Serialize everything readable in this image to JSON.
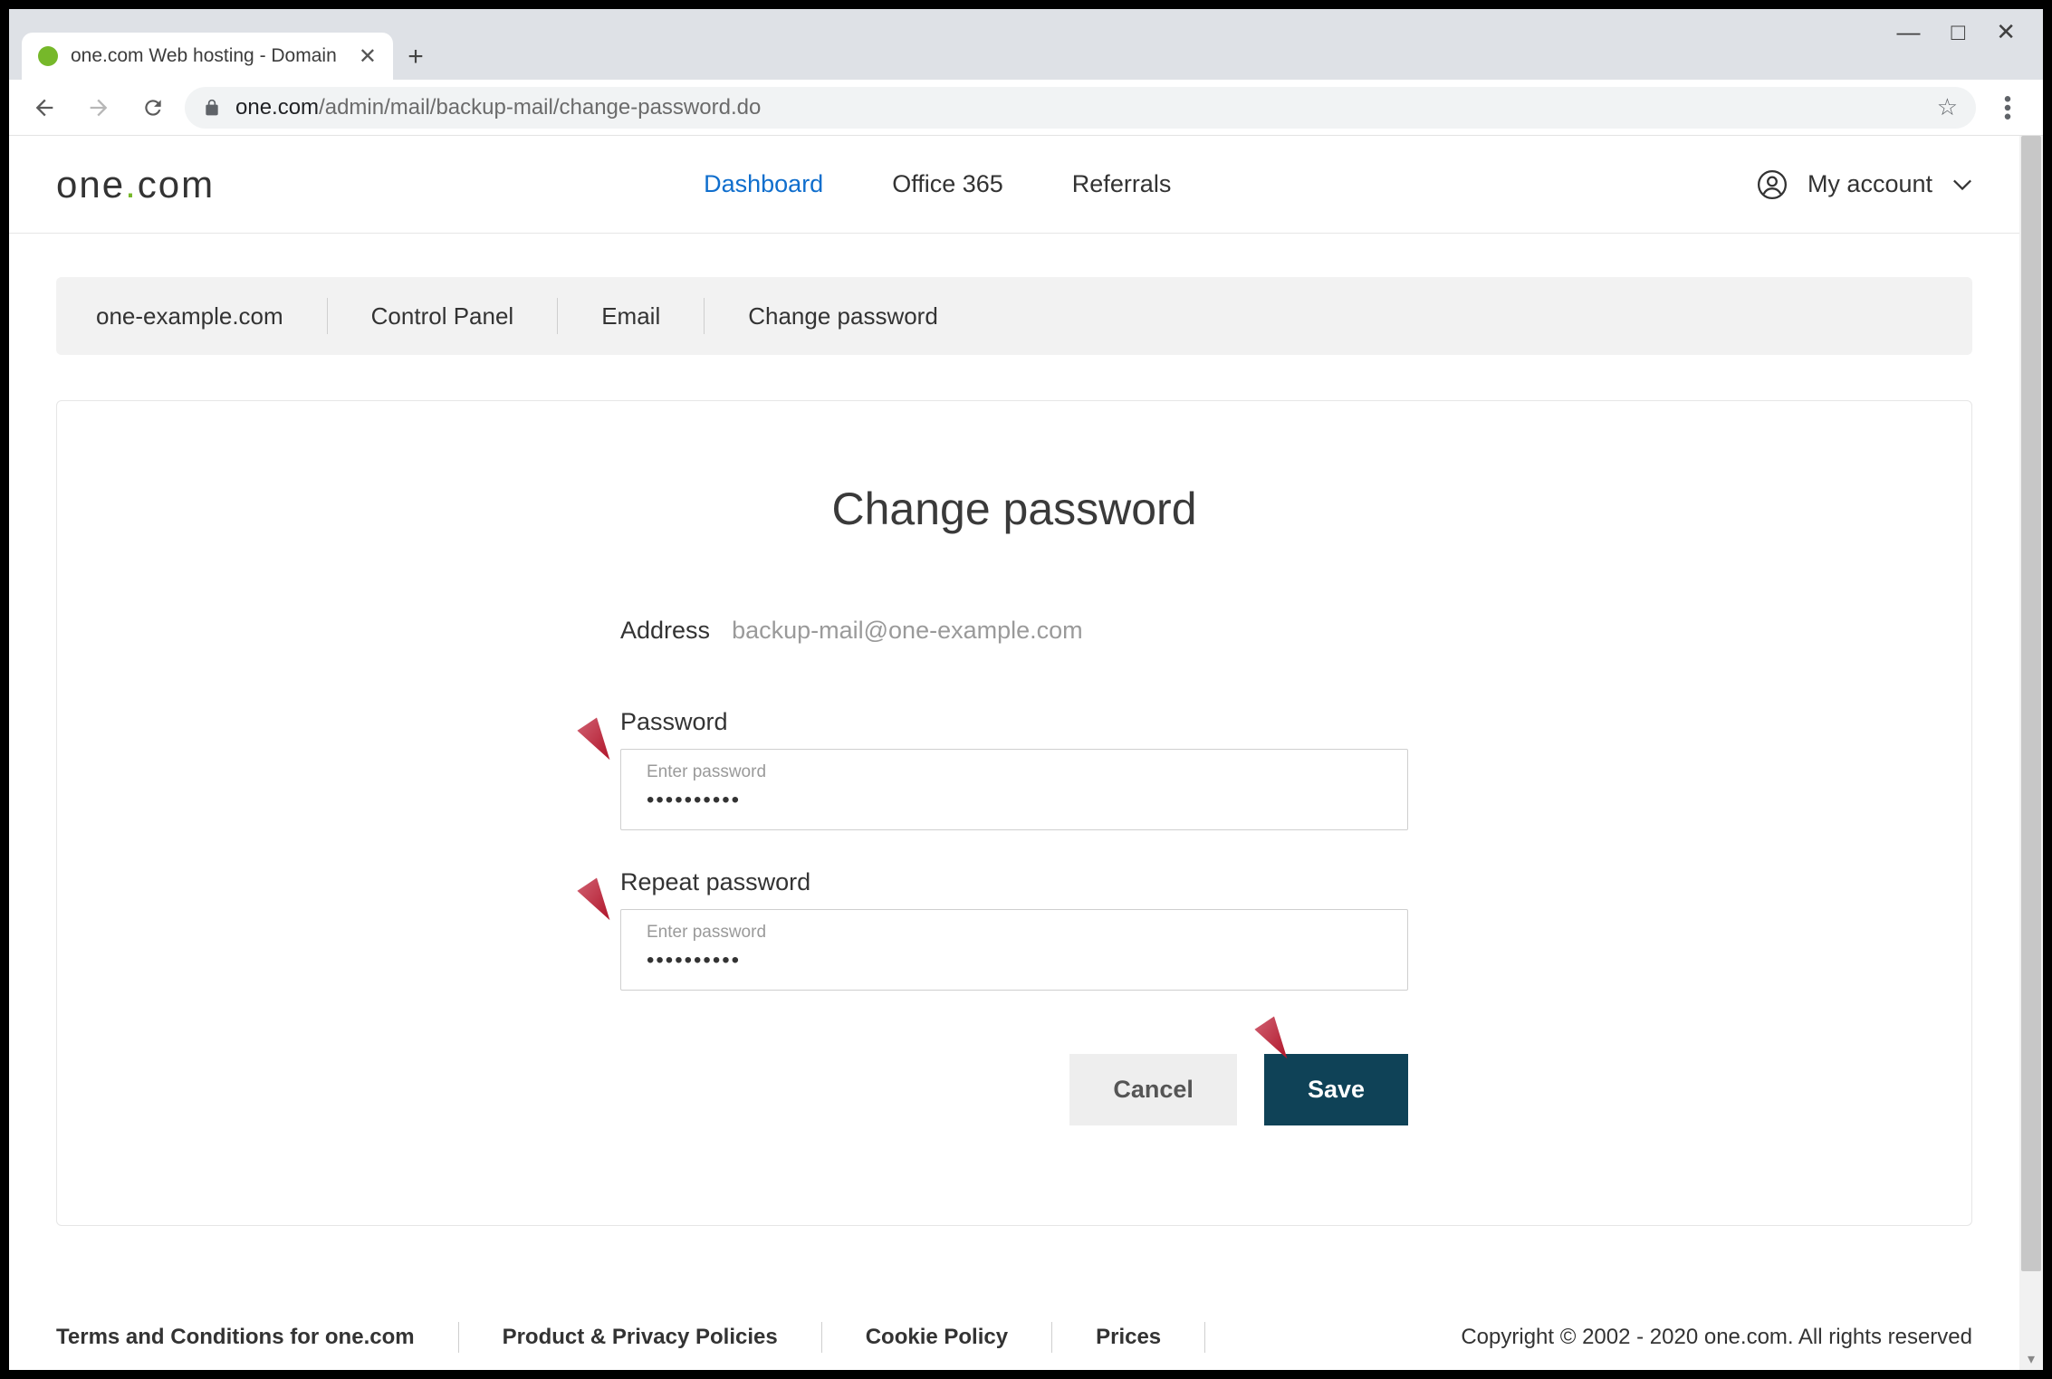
{
  "browser": {
    "tab_title": "one.com Web hosting  -  Domain",
    "url_host": "one.com",
    "url_path": "/admin/mail/backup-mail/change-password.do"
  },
  "logo": {
    "pre": "one",
    "dot": ".",
    "post": "com"
  },
  "nav": {
    "dashboard": "Dashboard",
    "office365": "Office 365",
    "referrals": "Referrals"
  },
  "account": {
    "label": "My account"
  },
  "breadcrumb": {
    "domain": "one-example.com",
    "panel": "Control Panel",
    "email": "Email",
    "page": "Change password"
  },
  "card": {
    "title": "Change password",
    "address_label": "Address",
    "address_value": "backup-mail@one-example.com",
    "password_label": "Password",
    "password_placeholder": "Enter password",
    "password_value": "••••••••••",
    "repeat_label": "Repeat password",
    "repeat_placeholder": "Enter password",
    "repeat_value": "••••••••••",
    "cancel": "Cancel",
    "save": "Save"
  },
  "footer": {
    "terms": "Terms and Conditions for one.com",
    "privacy": "Product & Privacy Policies",
    "cookie": "Cookie Policy",
    "prices": "Prices",
    "copyright": "Copyright © 2002 - 2020 one.com. All rights reserved"
  }
}
